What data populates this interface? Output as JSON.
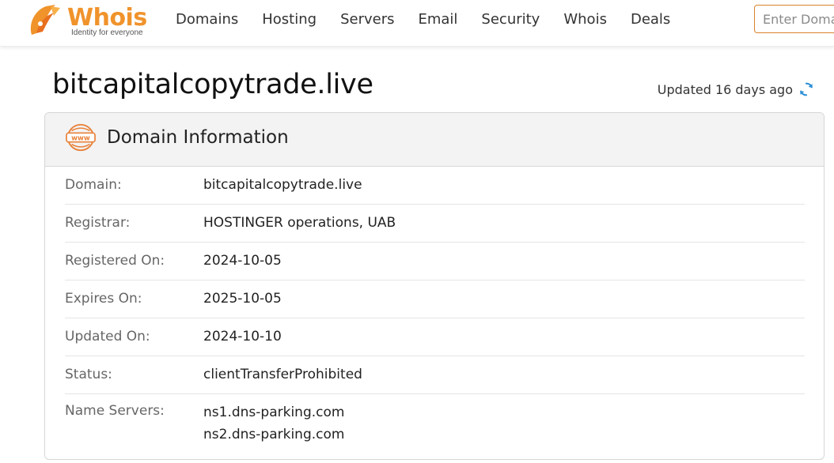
{
  "header": {
    "logo_word": "Whois",
    "logo_tagline": "Identity for everyone",
    "nav": [
      {
        "label": "Domains"
      },
      {
        "label": "Hosting"
      },
      {
        "label": "Servers"
      },
      {
        "label": "Email"
      },
      {
        "label": "Security"
      },
      {
        "label": "Whois"
      },
      {
        "label": "Deals"
      }
    ],
    "search": {
      "placeholder": "Enter Domain",
      "value": ""
    }
  },
  "page": {
    "title": "bitcapitalcopytrade.live",
    "updated_text": "Updated 16 days ago",
    "refresh_icon": "refresh-icon"
  },
  "domain_info": {
    "title": "Domain Information",
    "icon": "www-icon",
    "rows": [
      {
        "label": "Domain:",
        "value": "bitcapitalcopytrade.live"
      },
      {
        "label": "Registrar:",
        "value": "HOSTINGER operations, UAB"
      },
      {
        "label": "Registered On:",
        "value": "2024-10-05"
      },
      {
        "label": "Expires On:",
        "value": "2025-10-05"
      },
      {
        "label": "Updated On:",
        "value": "2024-10-10"
      },
      {
        "label": "Status:",
        "value": "clientTransferProhibited"
      }
    ],
    "name_servers": {
      "label": "Name Servers:",
      "values": [
        "ns1.dns-parking.com",
        "ns2.dns-parking.com"
      ]
    }
  },
  "colors": {
    "brand_orange": "#f0932b",
    "refresh_blue": "#2b8fd6"
  }
}
